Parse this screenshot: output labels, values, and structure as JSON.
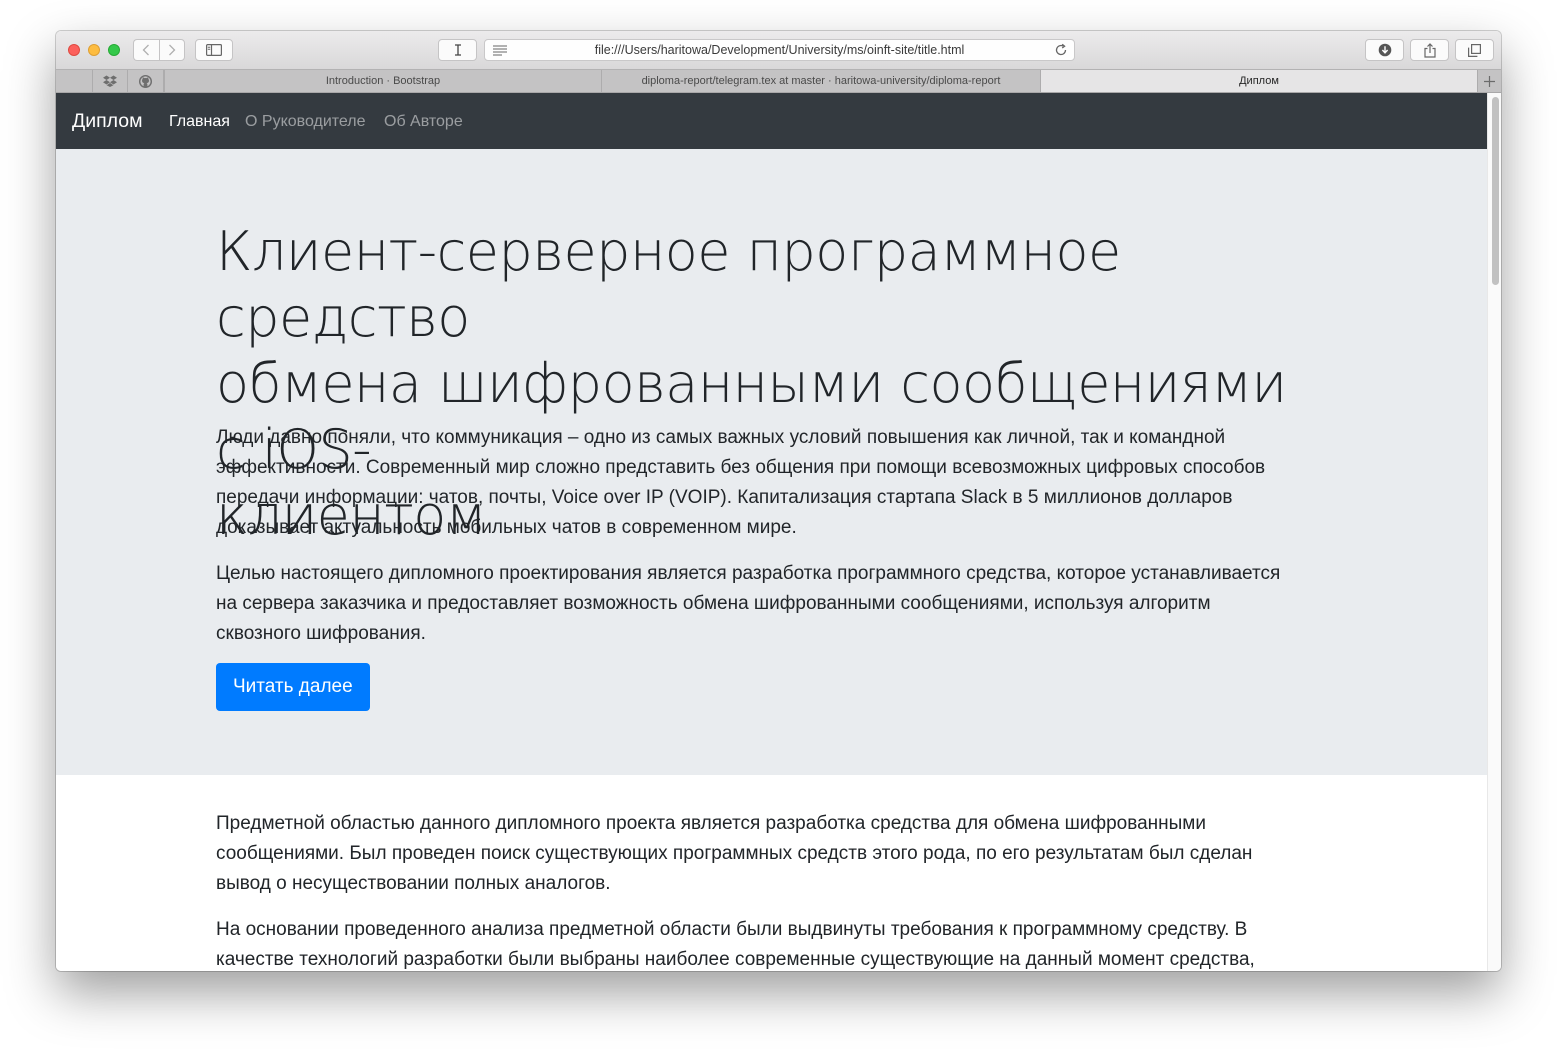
{
  "browser": {
    "url": "file:///Users/haritowa/Development/University/ms/oinft-site/title.html",
    "tabs": [
      {
        "label": "Introduction · Bootstrap",
        "active": false
      },
      {
        "label": "diploma-report/telegram.tex at master · haritowa-university/diploma-report",
        "active": false
      },
      {
        "label": "Диплом",
        "active": true
      }
    ],
    "pinned_tabs": [
      "dropbox-icon",
      "github-icon"
    ],
    "icons": [
      "back-icon",
      "forward-icon",
      "sidebar-icon",
      "text-cursor-icon",
      "reader-icon",
      "reload-icon",
      "download-icon",
      "share-icon",
      "tabs-overview-icon",
      "new-tab-icon"
    ]
  },
  "navbar": {
    "brand": "Диплом",
    "links": [
      {
        "label": "Главная",
        "active": true
      },
      {
        "label": "О Руководителе",
        "active": false
      },
      {
        "label": "Об Авторе",
        "active": false
      }
    ]
  },
  "hero": {
    "title_lines": [
      "Клиент-серверное программное средство",
      "обмена шифрованными сообщениями с iOS-",
      "клиентом"
    ],
    "paragraph1_lines": [
      "Люди давно поняли, что коммуникация – одно из самых важных условий повышения как личной, так и командной",
      "эффективности. Современный мир сложно представить без общения при помощи всевозможных цифровых способов",
      "передачи информации: чатов, почты, Voice over IP (VOIP). Капитализация стартапа Slack в 5 миллионов долларов",
      "доказывает актуальность мобильных чатов в современном мире."
    ],
    "paragraph2_lines": [
      "Целью настоящего дипломного проектирования является разработка программного средства, которое устанавливается",
      "на сервера заказчика и предоставляет возможность обмена шифрованными сообщениями, используя алгоритм",
      "сквозного шифрования."
    ],
    "button": "Читать далее"
  },
  "body": {
    "paragraph1_lines": [
      "Предметной областью данного дипломного проекта является разработка средства для обмена шифрованными",
      "сообщениями. Был проведен поиск существующих программных средств этого рода, по его результатам был сделан",
      "вывод о несуществовании полных аналогов."
    ],
    "paragraph2_lines": [
      "На основании проведенного анализа предметной области были выдвинуты требования к программному средству. В",
      "качестве технологий разработки были выбраны наиболее современные существующие на данный момент средства,"
    ]
  },
  "colors": {
    "navbar": "#343a40",
    "hero_bg": "#e9ecef",
    "primary": "#007bff",
    "text": "#212529"
  }
}
